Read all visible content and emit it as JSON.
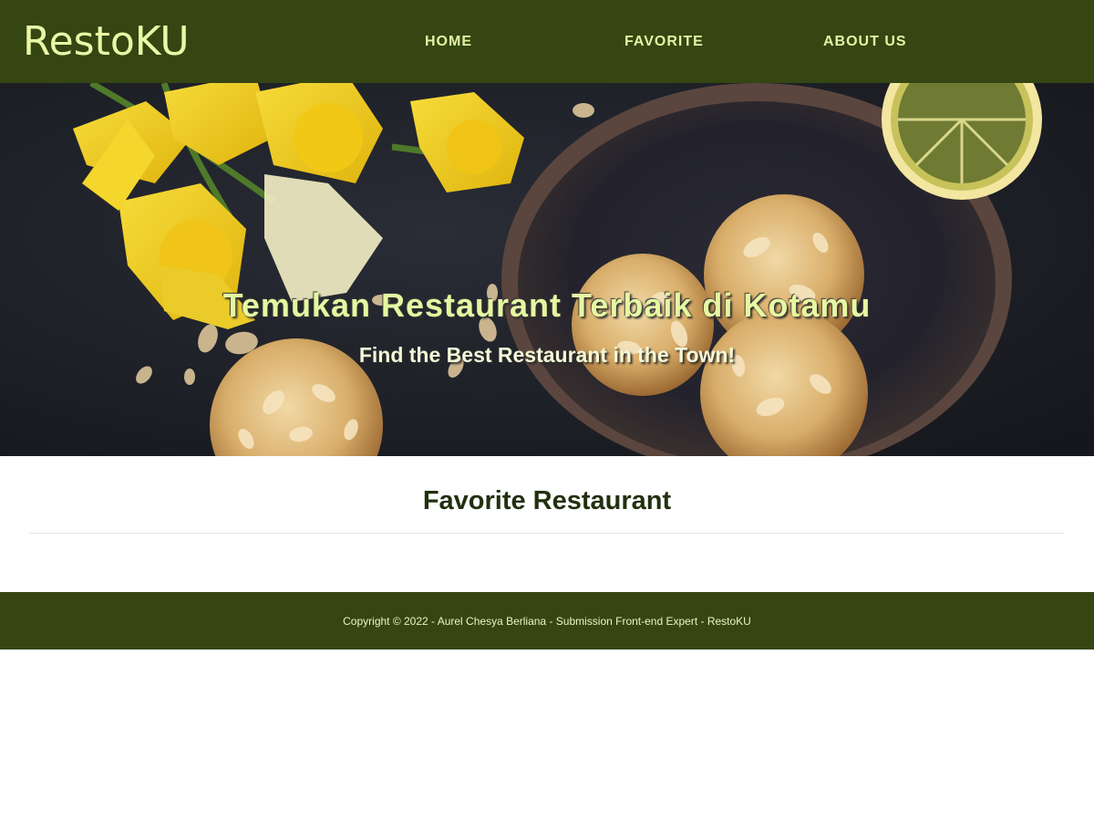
{
  "header": {
    "logo": "RestoKU",
    "nav": [
      {
        "label": "HOME"
      },
      {
        "label": "FAVORITE"
      },
      {
        "label": "ABOUT US"
      }
    ]
  },
  "hero": {
    "title": "Temukan Restaurant Terbaik di Kotamu",
    "subtitle": "Find the Best Restaurant in the Town!"
  },
  "main": {
    "title": "Favorite Restaurant"
  },
  "footer": {
    "copyright": "Copyright © 2022 - Aurel Chesya Berliana - Submission Front-end Expert - RestoKU"
  },
  "colors": {
    "brand": "#354613",
    "accent_text": "#e6f7a2",
    "heading": "#22300e"
  }
}
